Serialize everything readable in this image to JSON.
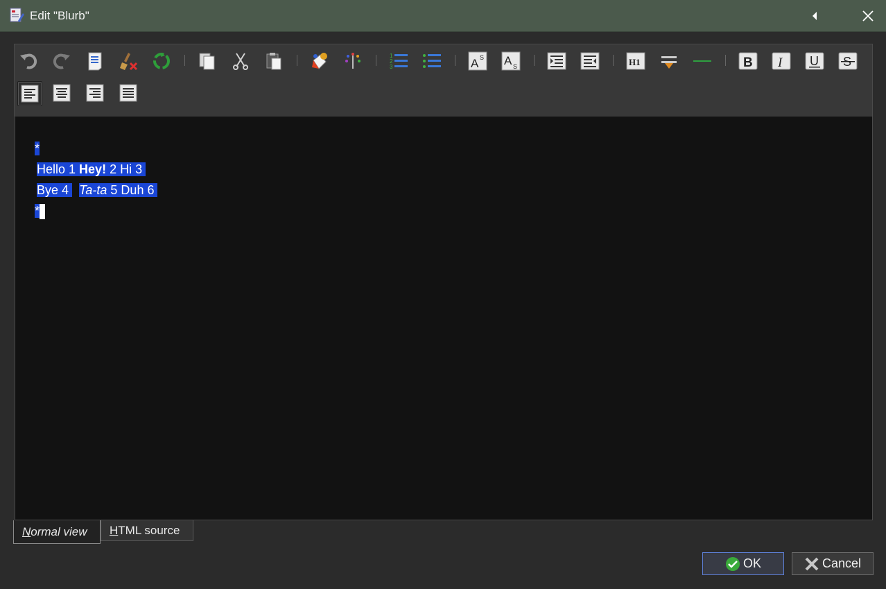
{
  "window": {
    "title": "Edit \"Blurb\""
  },
  "toolbar": {
    "row1": [
      {
        "name": "undo-icon"
      },
      {
        "name": "redo-icon"
      },
      {
        "name": "new-document-icon"
      },
      {
        "name": "clear-formatting-icon"
      },
      {
        "name": "recycle-icon"
      },
      {
        "name": "copy-icon"
      },
      {
        "name": "cut-icon"
      },
      {
        "name": "paste-icon"
      },
      {
        "name": "text-color-icon"
      },
      {
        "name": "background-color-icon"
      },
      {
        "name": "numbered-list-icon"
      },
      {
        "name": "bullet-list-icon"
      },
      {
        "name": "superscript-icon"
      },
      {
        "name": "subscript-icon"
      },
      {
        "name": "indent-icon"
      },
      {
        "name": "outdent-icon"
      },
      {
        "name": "heading-icon"
      },
      {
        "name": "insert-break-icon"
      },
      {
        "name": "horizontal-rule-icon"
      },
      {
        "name": "bold-icon"
      },
      {
        "name": "italic-icon"
      },
      {
        "name": "underline-icon"
      },
      {
        "name": "strikethrough-icon"
      }
    ],
    "heading_label": "H1",
    "bold_label": "B",
    "italic_label": "I",
    "underline_label": "U",
    "strike_label": "S",
    "super_label": "A",
    "super_sub": "S",
    "sub_label": "A",
    "sub_sub": "S",
    "active_align": "align-left"
  },
  "editor": {
    "line1": "*",
    "line2": {
      "a": "Hello 1 ",
      "b": "Hey!",
      "c": " 2 Hi 3 "
    },
    "line3": {
      "a": "Bye 4 ",
      "gap": "  ",
      "b": "Ta-ta",
      "c": " 5 Duh 6 "
    },
    "line4": "*"
  },
  "tabs": {
    "normal_first": "N",
    "normal_rest": "ormal view",
    "source_first": "H",
    "source_rest": "TML source"
  },
  "buttons": {
    "ok": "OK",
    "cancel": "Cancel"
  },
  "colors": {
    "selection": "#1a46d6",
    "titlebar": "#4b5a4c",
    "editor_bg": "#121212"
  }
}
